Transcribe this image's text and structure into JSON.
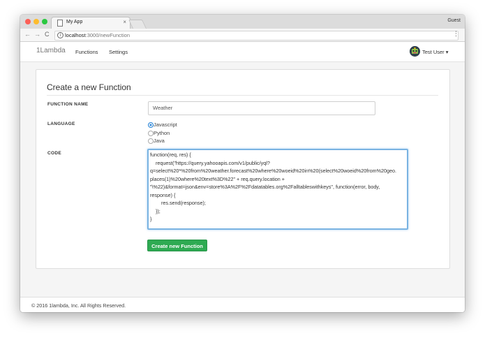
{
  "browser": {
    "tab_title": "My App",
    "tab_close": "×",
    "profile_label": "Guest",
    "url_host": "localhost",
    "url_rest": ":3000/newFunction",
    "back": "←",
    "forward": "→",
    "reload": "C",
    "info": "i",
    "menu": "⋮"
  },
  "navbar": {
    "brand": "1Lambda",
    "links": [
      "Functions",
      "Settings"
    ],
    "user": "Test User ▾"
  },
  "form": {
    "title": "Create a new Function",
    "name_label": "FUNCTION NAME",
    "name_value": "Weather",
    "language_label": "LANGUAGE",
    "languages": [
      "Javascript",
      "Python",
      "Java"
    ],
    "selected_language": "Javascript",
    "code_label": "CODE",
    "code_lines": [
      "function(req, res) {",
      "    request(\"https://query.yahooapis.com/v1/public/yql?",
      "q=select%20*%20from%20weather.forecast%20where%20woeid%20in%20(select%20woeid%20from%20geo.",
      "places(1)%20where%20text%3D%22\" + req.query.location +",
      "\"\\%22)&format=json&env=store%3A%2F%2Fdatatables.org%2Falltableswithkeys\", function(error, body,",
      "response) {",
      "        res.send(response);",
      "    });",
      "}"
    ],
    "submit_label": "Create new Function"
  },
  "footer": {
    "text": "© 2016 1lambda, Inc. All Rights Reserved."
  },
  "colors": {
    "accent_green": "#2eaa52",
    "focus_blue": "#7ab3e2",
    "radio_blue": "#2d87d8"
  }
}
